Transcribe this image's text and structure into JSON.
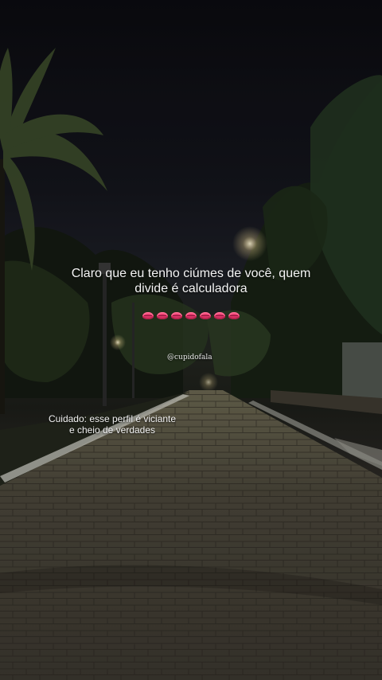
{
  "caption": {
    "line1": "Claro que eu tenho ciúmes de você, quem",
    "line2": "divide é calculadora"
  },
  "emoji_icon": "lips-icon",
  "emoji_count": 7,
  "handle": "@cupidofala",
  "warning": {
    "line1": "Cuidado: esse perfil é viciante",
    "line2": "e cheio de verdades"
  }
}
